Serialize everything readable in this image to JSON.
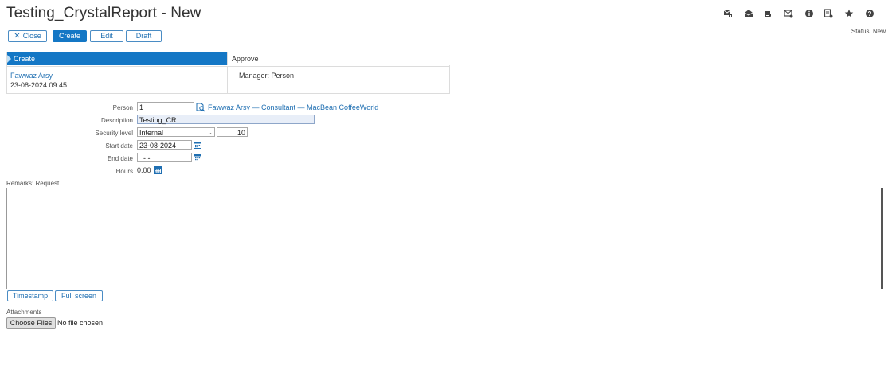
{
  "page": {
    "title": "Testing_CrystalReport - New",
    "status": "Status: New"
  },
  "toolbar": {
    "close": "Close",
    "create": "Create",
    "edit": "Edit",
    "draft": "Draft"
  },
  "toolbar_icons": [
    "mail-attach-icon",
    "envelope-open-icon",
    "printer-icon",
    "mail-gear-icon",
    "info-icon",
    "document-gear-icon",
    "star-icon",
    "help-icon"
  ],
  "workflow": {
    "steps": [
      {
        "label": "Create",
        "user": "Fawwaz Arsy",
        "timestamp": "23-08-2024 09:45",
        "active": true
      },
      {
        "label": "Approve",
        "note": "Manager: Person"
      }
    ]
  },
  "form": {
    "person": {
      "label": "Person",
      "value": "1",
      "link": "Fawwaz Arsy — Consultant — MacBean CoffeeWorld"
    },
    "description": {
      "label": "Description",
      "value": "Testing_CR"
    },
    "security": {
      "label": "Security level",
      "value": "Internal",
      "number": "10"
    },
    "start_date": {
      "label": "Start date",
      "value": "23-08-2024"
    },
    "end_date": {
      "label": "End date",
      "value": "- -"
    },
    "hours": {
      "label": "Hours",
      "value": "0.00"
    }
  },
  "remarks": {
    "label": "Remarks: Request",
    "timestamp_button": "Timestamp",
    "fullscreen_button": "Full screen"
  },
  "attachments": {
    "label": "Attachments",
    "choose_button": "Choose Files",
    "no_file": "No file chosen"
  },
  "colors": {
    "accent": "#1477c5",
    "link": "#1f6fb2"
  }
}
